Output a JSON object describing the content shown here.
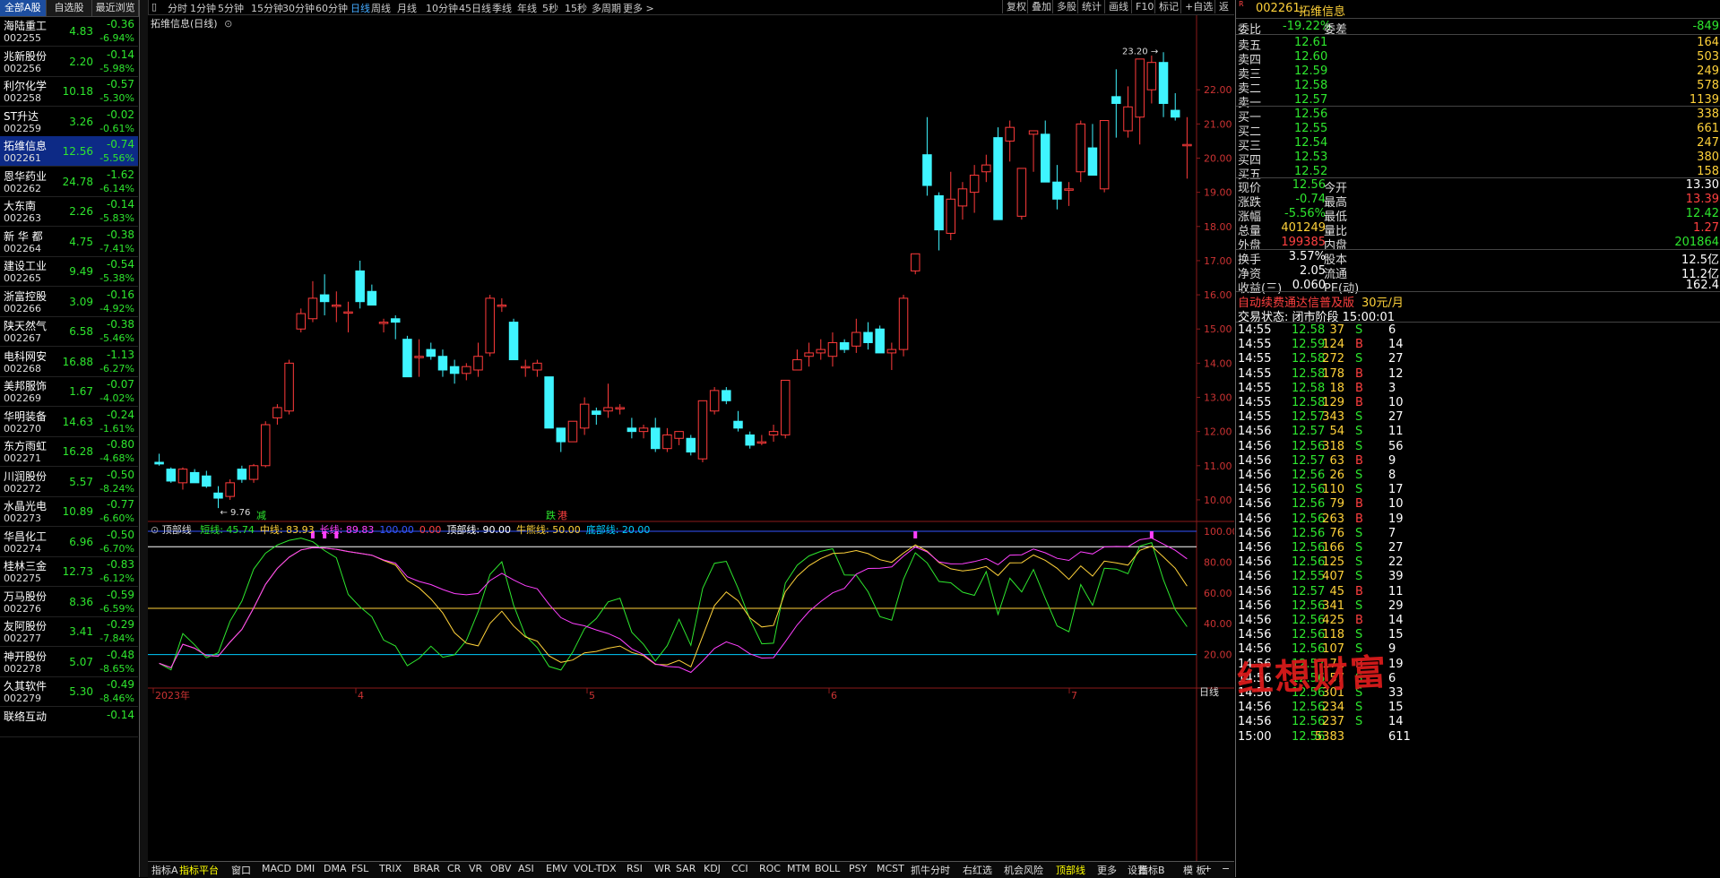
{
  "left_tabs": [
    "全部A股",
    "自选股",
    "最近浏览"
  ],
  "stocks": [
    {
      "name": "海陆重工",
      "code": "002255",
      "price": "4.83",
      "chg": "-0.36",
      "pct": "-6.94%"
    },
    {
      "name": "兆新股份",
      "code": "002256",
      "price": "2.20",
      "chg": "-0.14",
      "pct": "-5.98%"
    },
    {
      "name": "利尔化学",
      "code": "002258",
      "price": "10.18",
      "chg": "-0.57",
      "pct": "-5.30%"
    },
    {
      "name": "ST升达",
      "code": "002259",
      "price": "3.26",
      "chg": "-0.02",
      "pct": "-0.61%"
    },
    {
      "name": "拓维信息",
      "code": "002261",
      "price": "12.56",
      "chg": "-0.74",
      "pct": "-5.56%"
    },
    {
      "name": "恩华药业",
      "code": "002262",
      "price": "24.78",
      "chg": "-1.62",
      "pct": "-6.14%"
    },
    {
      "name": "大东南",
      "code": "002263",
      "price": "2.26",
      "chg": "-0.14",
      "pct": "-5.83%"
    },
    {
      "name": "新 华 都",
      "code": "002264",
      "price": "4.75",
      "chg": "-0.38",
      "pct": "-7.41%"
    },
    {
      "name": "建设工业",
      "code": "002265",
      "price": "9.49",
      "chg": "-0.54",
      "pct": "-5.38%"
    },
    {
      "name": "浙富控股",
      "code": "002266",
      "price": "3.09",
      "chg": "-0.16",
      "pct": "-4.92%"
    },
    {
      "name": "陕天然气",
      "code": "002267",
      "price": "6.58",
      "chg": "-0.38",
      "pct": "-5.46%"
    },
    {
      "name": "电科网安",
      "code": "002268",
      "price": "16.88",
      "chg": "-1.13",
      "pct": "-6.27%"
    },
    {
      "name": "美邦服饰",
      "code": "002269",
      "price": "1.67",
      "chg": "-0.07",
      "pct": "-4.02%"
    },
    {
      "name": "华明装备",
      "code": "002270",
      "price": "14.63",
      "chg": "-0.24",
      "pct": "-1.61%"
    },
    {
      "name": "东方雨虹",
      "code": "002271",
      "price": "16.28",
      "chg": "-0.80",
      "pct": "-4.68%"
    },
    {
      "name": "川润股份",
      "code": "002272",
      "price": "5.57",
      "chg": "-0.50",
      "pct": "-8.24%"
    },
    {
      "name": "水晶光电",
      "code": "002273",
      "price": "10.89",
      "chg": "-0.77",
      "pct": "-6.60%"
    },
    {
      "name": "华昌化工",
      "code": "002274",
      "price": "6.96",
      "chg": "-0.50",
      "pct": "-6.70%"
    },
    {
      "name": "桂林三金",
      "code": "002275",
      "price": "12.73",
      "chg": "-0.83",
      "pct": "-6.12%"
    },
    {
      "name": "万马股份",
      "code": "002276",
      "price": "8.36",
      "chg": "-0.59",
      "pct": "-6.59%"
    },
    {
      "name": "友阿股份",
      "code": "002277",
      "price": "3.41",
      "chg": "-0.29",
      "pct": "-7.84%"
    },
    {
      "name": "神开股份",
      "code": "002278",
      "price": "5.07",
      "chg": "-0.48",
      "pct": "-8.65%"
    },
    {
      "name": "久其软件",
      "code": "002279",
      "price": "5.30",
      "chg": "-0.49",
      "pct": "-8.46%"
    },
    {
      "name": "联络互动",
      "code": "",
      "price": "",
      "chg": "-0.14",
      "pct": ""
    }
  ],
  "toolbar": {
    "periods": [
      "分时",
      "1分钟",
      "5分钟",
      "15分钟",
      "30分钟",
      "60分钟",
      "日线",
      "周线",
      "月线",
      "10分钟",
      "45日线",
      "季线",
      "年线",
      "5秒",
      "15秒",
      "多周期",
      "更多 >"
    ],
    "right_buttons": [
      "复权",
      "叠加",
      "多股",
      "统计",
      "画线",
      "F10",
      "标记",
      "+自选",
      "返回"
    ]
  },
  "chart": {
    "title": "拓维信息(日线)",
    "high_label": "23.20",
    "low_label": "9.76",
    "markers": {
      "buy": "减",
      "up": "跌",
      "dn": "港"
    },
    "y_labels": [
      "22.00",
      "21.00",
      "20.00",
      "19.00",
      "18.00",
      "17.00",
      "16.00",
      "15.00",
      "14.00",
      "13.00",
      "12.00",
      "11.00",
      "10.00"
    ],
    "x_labels": [
      "2023年",
      "4",
      "5",
      "6",
      "7"
    ],
    "corner_label": "日线"
  },
  "indicator": {
    "name": "顶部线",
    "legend": [
      {
        "text": "短线: 45.74",
        "color": "#2ee62e"
      },
      {
        "text": "中线: 83.93",
        "color": "#ffd23a"
      },
      {
        "text": "长线: 89.83",
        "color": "#ff40ff"
      },
      {
        "text": "100.00",
        "color": "#3355ff"
      },
      {
        "text": "0.00",
        "color": "#ff4040"
      },
      {
        "text": "顶部线: 90.00",
        "color": "#ffffff"
      },
      {
        "text": "牛熊线: 50.00",
        "color": "#ffd23a"
      },
      {
        "text": "底部线: 20.00",
        "color": "#0cf"
      }
    ],
    "y_labels": [
      "100.00",
      "80.00",
      "60.00",
      "40.00",
      "20.00"
    ]
  },
  "chart_data": {
    "type": "candlestick",
    "title": "拓维信息(日线)",
    "ylim": [
      9.5,
      23.5
    ],
    "ohlc": [
      [
        11.1,
        11.35,
        11.0,
        11.05
      ],
      [
        10.9,
        10.95,
        10.5,
        10.55
      ],
      [
        10.5,
        10.95,
        10.3,
        10.9
      ],
      [
        10.8,
        10.9,
        10.5,
        10.5
      ],
      [
        10.7,
        10.85,
        10.35,
        10.4
      ],
      [
        10.2,
        10.4,
        9.76,
        10.05
      ],
      [
        10.1,
        10.6,
        10.0,
        10.5
      ],
      [
        10.9,
        11.0,
        10.5,
        10.6
      ],
      [
        10.6,
        11.05,
        10.5,
        11.0
      ],
      [
        11.0,
        12.3,
        10.95,
        12.2
      ],
      [
        12.4,
        12.8,
        12.2,
        12.7
      ],
      [
        12.6,
        14.1,
        12.5,
        14.0
      ],
      [
        15.0,
        15.6,
        14.9,
        15.45
      ],
      [
        15.3,
        16.4,
        15.2,
        15.9
      ],
      [
        16.0,
        16.6,
        15.4,
        15.8
      ],
      [
        15.7,
        16.1,
        15.2,
        15.7
      ],
      [
        15.5,
        15.8,
        14.9,
        15.5
      ],
      [
        16.7,
        17.0,
        15.6,
        15.8
      ],
      [
        16.1,
        16.3,
        15.7,
        15.7
      ],
      [
        15.2,
        15.3,
        14.9,
        15.2
      ],
      [
        15.3,
        15.4,
        14.7,
        15.2
      ],
      [
        14.7,
        14.8,
        13.6,
        13.6
      ],
      [
        14.2,
        14.7,
        13.6,
        14.2
      ],
      [
        14.4,
        14.6,
        14.1,
        14.2
      ],
      [
        14.2,
        14.4,
        13.6,
        13.8
      ],
      [
        13.9,
        14.1,
        13.4,
        13.7
      ],
      [
        13.7,
        14.0,
        13.5,
        13.9
      ],
      [
        13.8,
        14.6,
        13.6,
        14.2
      ],
      [
        14.3,
        16.0,
        14.2,
        15.9
      ],
      [
        15.7,
        15.9,
        15.5,
        15.7
      ],
      [
        15.2,
        15.3,
        14.1,
        14.1
      ],
      [
        13.9,
        14.1,
        13.6,
        13.9
      ],
      [
        13.8,
        14.1,
        13.6,
        14.0
      ],
      [
        13.6,
        13.6,
        12.1,
        12.1
      ],
      [
        12.1,
        12.1,
        11.4,
        11.7
      ],
      [
        11.7,
        12.3,
        11.7,
        12.3
      ],
      [
        12.1,
        13.0,
        11.9,
        12.8
      ],
      [
        12.6,
        12.7,
        12.2,
        12.5
      ],
      [
        12.6,
        13.4,
        12.4,
        12.7
      ],
      [
        12.7,
        12.8,
        12.5,
        12.7
      ],
      [
        12.1,
        12.4,
        11.8,
        12.0
      ],
      [
        12.0,
        12.2,
        11.8,
        12.1
      ],
      [
        12.1,
        12.4,
        11.4,
        11.5
      ],
      [
        11.5,
        12.1,
        11.4,
        11.9
      ],
      [
        11.8,
        12.0,
        11.6,
        12.0
      ],
      [
        11.8,
        11.9,
        11.3,
        11.4
      ],
      [
        11.2,
        12.9,
        11.1,
        12.9
      ],
      [
        12.6,
        13.3,
        12.5,
        13.2
      ],
      [
        13.2,
        13.3,
        12.8,
        12.9
      ],
      [
        12.3,
        12.6,
        12.0,
        12.1
      ],
      [
        11.9,
        12.0,
        11.5,
        11.6
      ],
      [
        11.7,
        11.9,
        11.6,
        11.7
      ],
      [
        11.9,
        12.2,
        11.7,
        12.0
      ],
      [
        11.9,
        13.4,
        11.8,
        13.5
      ],
      [
        13.8,
        14.4,
        13.8,
        14.1
      ],
      [
        14.2,
        14.6,
        13.9,
        14.3
      ],
      [
        14.3,
        14.7,
        14.1,
        14.4
      ],
      [
        14.2,
        14.9,
        13.9,
        14.6
      ],
      [
        14.6,
        14.7,
        14.3,
        14.4
      ],
      [
        14.5,
        15.3,
        14.3,
        14.9
      ],
      [
        14.9,
        15.2,
        14.4,
        14.6
      ],
      [
        15.0,
        15.1,
        14.3,
        14.3
      ],
      [
        14.3,
        14.6,
        13.8,
        14.4
      ],
      [
        14.4,
        16.0,
        14.2,
        15.9
      ],
      [
        16.7,
        17.1,
        16.6,
        17.2
      ],
      [
        20.1,
        21.2,
        18.9,
        19.2
      ],
      [
        18.9,
        19.0,
        17.3,
        17.9
      ],
      [
        17.8,
        19.6,
        17.6,
        18.8
      ],
      [
        18.6,
        19.3,
        18.2,
        19.1
      ],
      [
        19.0,
        19.8,
        18.4,
        19.5
      ],
      [
        19.6,
        20.1,
        19.3,
        19.8
      ],
      [
        20.6,
        20.9,
        18.3,
        18.2
      ],
      [
        20.5,
        21.1,
        19.9,
        20.9
      ],
      [
        18.3,
        19.7,
        18.2,
        19.7
      ],
      [
        20.7,
        20.8,
        19.6,
        20.8
      ],
      [
        20.7,
        21.1,
        19.6,
        19.3
      ],
      [
        19.3,
        19.8,
        18.5,
        18.8
      ],
      [
        19.1,
        19.3,
        18.6,
        19.1
      ],
      [
        19.6,
        21.1,
        19.3,
        21.0
      ],
      [
        20.3,
        21.0,
        19.5,
        19.5
      ],
      [
        19.1,
        20.6,
        19.0,
        21.1
      ],
      [
        21.8,
        22.6,
        20.6,
        21.6
      ],
      [
        20.8,
        22.1,
        20.6,
        21.5
      ],
      [
        21.2,
        22.6,
        20.4,
        22.9
      ],
      [
        22.0,
        23.0,
        21.6,
        22.8
      ],
      [
        22.8,
        23.1,
        21.2,
        21.6
      ],
      [
        21.4,
        21.9,
        21.1,
        21.2
      ],
      [
        20.4,
        21.2,
        19.4,
        20.4
      ]
    ]
  },
  "quote": {
    "code": "002261",
    "name": "拓维信息",
    "weibi_label": "委比",
    "weibi": "-19.22%",
    "weicha_label": "委差",
    "weicha": "-849",
    "asks": [
      {
        "label": "卖五",
        "price": "12.61",
        "vol": "164"
      },
      {
        "label": "卖四",
        "price": "12.60",
        "vol": "503"
      },
      {
        "label": "卖三",
        "price": "12.59",
        "vol": "249"
      },
      {
        "label": "卖二",
        "price": "12.58",
        "vol": "578"
      },
      {
        "label": "卖一",
        "price": "12.57",
        "vol": "1139"
      }
    ],
    "bids": [
      {
        "label": "买一",
        "price": "12.56",
        "vol": "338"
      },
      {
        "label": "买二",
        "price": "12.55",
        "vol": "661"
      },
      {
        "label": "买三",
        "price": "12.54",
        "vol": "247"
      },
      {
        "label": "买四",
        "price": "12.53",
        "vol": "380"
      },
      {
        "label": "买五",
        "price": "12.52",
        "vol": "158"
      }
    ],
    "stats": [
      {
        "l1": "现价",
        "v1": "12.56",
        "c1": "g",
        "l2": "今开",
        "v2": "13.30",
        "c2": "w"
      },
      {
        "l1": "涨跌",
        "v1": "-0.74",
        "c1": "g",
        "l2": "最高",
        "v2": "13.39",
        "c2": "r"
      },
      {
        "l1": "涨幅",
        "v1": "-5.56%",
        "c1": "g",
        "l2": "最低",
        "v2": "12.42",
        "c2": "g"
      },
      {
        "l1": "总量",
        "v1": "401249",
        "c1": "y",
        "l2": "量比",
        "v2": "1.27",
        "c2": "r"
      },
      {
        "l1": "外盘",
        "v1": "199385",
        "c1": "r",
        "l2": "内盘",
        "v2": "201864",
        "c2": "g"
      }
    ],
    "stats2": [
      {
        "l1": "换手",
        "v1": "3.57%",
        "l2": "股本",
        "v2": "12.5亿"
      },
      {
        "l1": "净资",
        "v1": "2.05",
        "l2": "流通",
        "v2": "11.2亿"
      },
      {
        "l1": "收益(三)",
        "v1": "0.060",
        "l2": "PE(动)",
        "v2": "162.4"
      }
    ],
    "ad_text": "自动续费通达信普及版",
    "ad_price": "30元/月",
    "trade_status": "交易状态: 闭市阶段 15:00:01"
  },
  "ticks": [
    {
      "t": "14:55",
      "p": "12.58",
      "v": "37",
      "s": "S",
      "n": "6"
    },
    {
      "t": "14:55",
      "p": "12.59",
      "v": "124",
      "s": "B",
      "n": "14"
    },
    {
      "t": "14:55",
      "p": "12.58",
      "v": "272",
      "s": "S",
      "n": "27"
    },
    {
      "t": "14:55",
      "p": "12.58",
      "v": "178",
      "s": "B",
      "n": "12"
    },
    {
      "t": "14:55",
      "p": "12.58",
      "v": "18",
      "s": "B",
      "n": "3"
    },
    {
      "t": "14:55",
      "p": "12.58",
      "v": "129",
      "s": "B",
      "n": "10"
    },
    {
      "t": "14:55",
      "p": "12.57",
      "v": "343",
      "s": "S",
      "n": "27"
    },
    {
      "t": "14:56",
      "p": "12.57",
      "v": "54",
      "s": "S",
      "n": "11"
    },
    {
      "t": "14:56",
      "p": "12.56",
      "v": "318",
      "s": "S",
      "n": "56"
    },
    {
      "t": "14:56",
      "p": "12.57",
      "v": "63",
      "s": "B",
      "n": "9"
    },
    {
      "t": "14:56",
      "p": "12.56",
      "v": "26",
      "s": "S",
      "n": "8"
    },
    {
      "t": "14:56",
      "p": "12.56",
      "v": "110",
      "s": "S",
      "n": "17"
    },
    {
      "t": "14:56",
      "p": "12.56",
      "v": "79",
      "s": "B",
      "n": "10"
    },
    {
      "t": "14:56",
      "p": "12.56",
      "v": "263",
      "s": "B",
      "n": "19"
    },
    {
      "t": "14:56",
      "p": "12.56",
      "v": "76",
      "s": "S",
      "n": "7"
    },
    {
      "t": "14:56",
      "p": "12.56",
      "v": "166",
      "s": "S",
      "n": "27"
    },
    {
      "t": "14:56",
      "p": "12.56",
      "v": "125",
      "s": "S",
      "n": "22"
    },
    {
      "t": "14:56",
      "p": "12.55",
      "v": "407",
      "s": "S",
      "n": "39"
    },
    {
      "t": "14:56",
      "p": "12.57",
      "v": "45",
      "s": "B",
      "n": "11"
    },
    {
      "t": "14:56",
      "p": "12.56",
      "v": "341",
      "s": "S",
      "n": "29"
    },
    {
      "t": "14:56",
      "p": "12.56",
      "v": "425",
      "s": "B",
      "n": "14"
    },
    {
      "t": "14:56",
      "p": "12.56",
      "v": "118",
      "s": "S",
      "n": "15"
    },
    {
      "t": "14:56",
      "p": "12.56",
      "v": "107",
      "s": "S",
      "n": "9"
    },
    {
      "t": "14:56",
      "p": "12.57",
      "v": "171",
      "s": "B",
      "n": "19"
    },
    {
      "t": "14:56",
      "p": "12.56",
      "v": "57",
      "s": "S",
      "n": "6"
    },
    {
      "t": "14:56",
      "p": "12.56",
      "v": "301",
      "s": "S",
      "n": "33"
    },
    {
      "t": "14:56",
      "p": "12.56",
      "v": "234",
      "s": "S",
      "n": "15"
    },
    {
      "t": "14:56",
      "p": "12.56",
      "v": "237",
      "s": "S",
      "n": "14"
    },
    {
      "t": "15:00",
      "p": "12.56",
      "v": "5383",
      "s": "",
      "n": "611"
    }
  ],
  "bottom_tabs": [
    "指标A",
    "指标平台",
    "窗口",
    "MACD",
    "DMI",
    "DMA",
    "FSL",
    "TRIX",
    "BRAR",
    "CR",
    "VR",
    "OBV",
    "ASI",
    "EMV",
    "VOL-TDX",
    "RSI",
    "WR",
    "SAR",
    "KDJ",
    "CCI",
    "ROC",
    "MTM",
    "BOLL",
    "PSY",
    "MCST",
    "抓牛分时",
    "右红选",
    "机会风险",
    "顶部线",
    "更多",
    "设置"
  ],
  "bottom_right": [
    "指标B",
    "模 板",
    "+",
    "−"
  ],
  "watermark": "红想财富"
}
